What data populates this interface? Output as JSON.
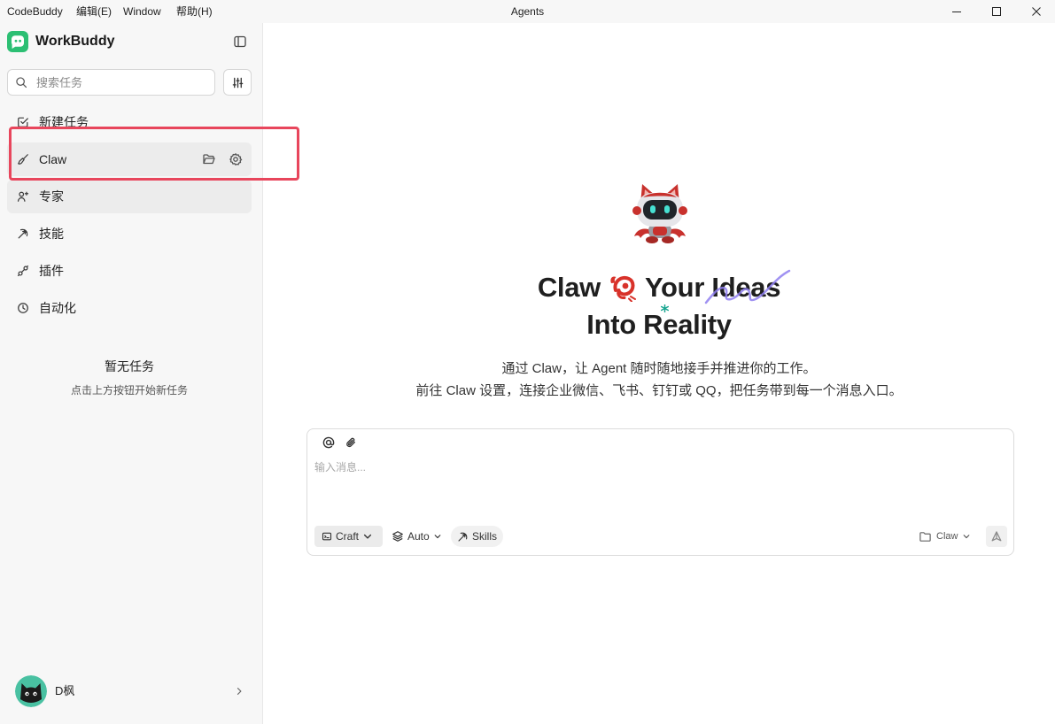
{
  "window": {
    "menu": [
      "CodeBuddy",
      "编辑(E)",
      "Window",
      "帮助(H)"
    ],
    "title": "Agents"
  },
  "sidebar": {
    "brand": "WorkBuddy",
    "search_placeholder": "搜索任务",
    "nav": [
      {
        "label": "新建任务",
        "icon": "new-task-icon"
      },
      {
        "label": "Claw",
        "icon": "claw-brush-icon"
      },
      {
        "label": "专家",
        "icon": "experts-icon"
      },
      {
        "label": "技能",
        "icon": "pickaxe-icon"
      },
      {
        "label": "插件",
        "icon": "plugin-icon"
      },
      {
        "label": "自动化",
        "icon": "clock-icon"
      }
    ],
    "empty": {
      "title": "暂无任务",
      "hint": "点击上方按钮开始新任务"
    },
    "user": {
      "name": "D枫"
    }
  },
  "main": {
    "heading": {
      "line1_a": "Claw",
      "line1_b": "Your Ideas",
      "line2": "Into Reality"
    },
    "description": [
      "通过 Claw，让 Agent 随时随地接手并推进你的工作。",
      "前往 Claw 设置，连接企业微信、飞书、钉钉或 QQ，把任务带到每一个消息入口。"
    ],
    "composer": {
      "placeholder": "输入消息...",
      "mode": "Craft",
      "model": "Auto",
      "skills": "Skills",
      "workspace": "Claw"
    }
  },
  "colors": {
    "brand_green": "#2cbf73",
    "highlight_red": "#e8465c",
    "lobster_red": "#d8322a",
    "scribble_purple": "#8f7ff0",
    "asterisk_teal": "#17a58f",
    "sidebar_bg": "#f7f7f7",
    "active_row_bg": "#ececec"
  }
}
